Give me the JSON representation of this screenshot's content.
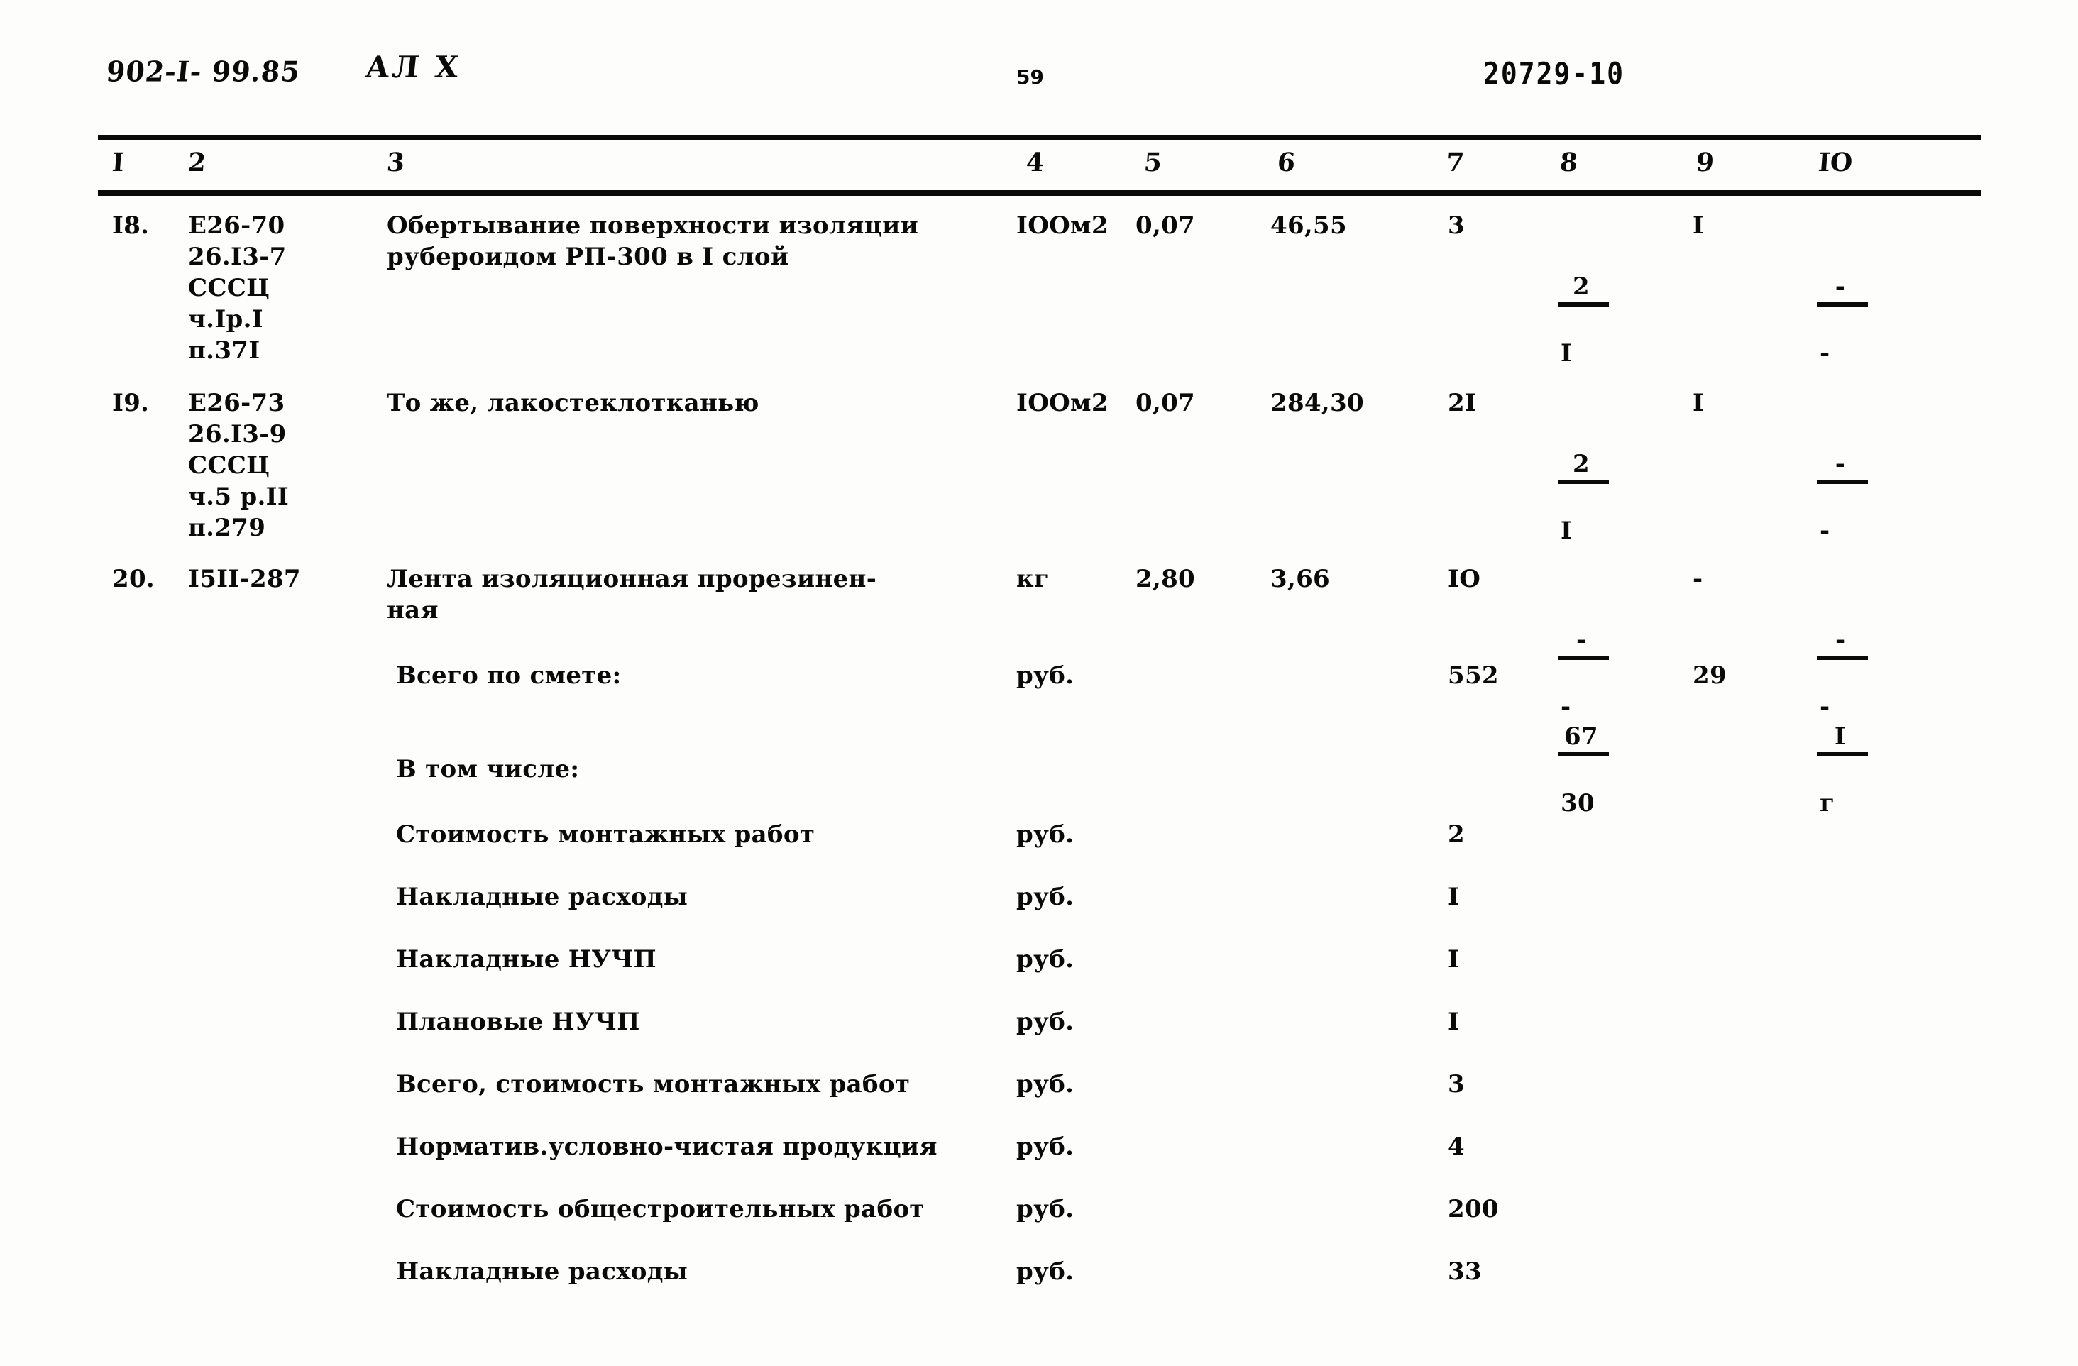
{
  "header": {
    "doc_code": "902-I- 99.85",
    "doc_code_suffix": "АЛ X",
    "page_number": "59",
    "sheet_code": "20729-10"
  },
  "table": {
    "column_headers": [
      "I",
      "2",
      "3",
      "4",
      "5",
      "6",
      "7",
      "8",
      "9",
      "IO"
    ],
    "rows": [
      {
        "num": "I8.",
        "code": "E26-70\n26.I3-7\nСССЦ\nч.Iр.I\nп.37I",
        "desc": "Обертывание поверхности изоляции\nрубероидом РП-300 в I слой",
        "unit": "IOOм2",
        "qty": "0,07",
        "price": "46,55",
        "sum": "3",
        "col8_top": "2",
        "col8_bot": "I",
        "col9": "I",
        "col10_top": "-",
        "col10_bot": "-"
      },
      {
        "num": "I9.",
        "code": "E26-73\n26.I3-9\nСССЦ\nч.5 р.II\nп.279",
        "desc": "То же, лакостеклотканью",
        "unit": "IOOм2",
        "qty": "0,07",
        "price": "284,30",
        "sum": "2I",
        "col8_top": "2",
        "col8_bot": "I",
        "col9": "I",
        "col10_top": "-",
        "col10_bot": "-"
      },
      {
        "num": "20.",
        "code": "I5II-287",
        "desc": "Лента изоляционная прорезинен-\nная",
        "unit": "кг",
        "qty": "2,80",
        "price": "3,66",
        "sum": "IO",
        "col8_top": "-",
        "col8_bot": "-",
        "col9": "-",
        "col10_top": "-",
        "col10_bot": "-"
      }
    ],
    "total_row": {
      "label": "Всего по смете:",
      "unit": "руб.",
      "sum": "552",
      "col8_top": "67",
      "col8_bot": "30",
      "col9": "29",
      "col10_top": "I",
      "col10_bot": "г"
    },
    "breakdown_header": "В том числе:",
    "breakdown": [
      {
        "label": "Стоимость монтажных работ",
        "unit": "руб.",
        "value": "2"
      },
      {
        "label": "Накладные расходы",
        "unit": "руб.",
        "value": "I"
      },
      {
        "label": "Накладные НУЧП",
        "unit": "руб.",
        "value": "I"
      },
      {
        "label": "Плановые НУЧП",
        "unit": "руб.",
        "value": "I"
      },
      {
        "label": "Всего, стоимость монтажных работ",
        "unit": "руб.",
        "value": "3"
      },
      {
        "label": "Норматив.условно-чистая продукция",
        "unit": "руб.",
        "value": "4"
      },
      {
        "label": "Стоимость общестроительных работ",
        "unit": "руб.",
        "value": "200"
      },
      {
        "label": "Накладные расходы",
        "unit": "руб.",
        "value": "33"
      }
    ]
  }
}
